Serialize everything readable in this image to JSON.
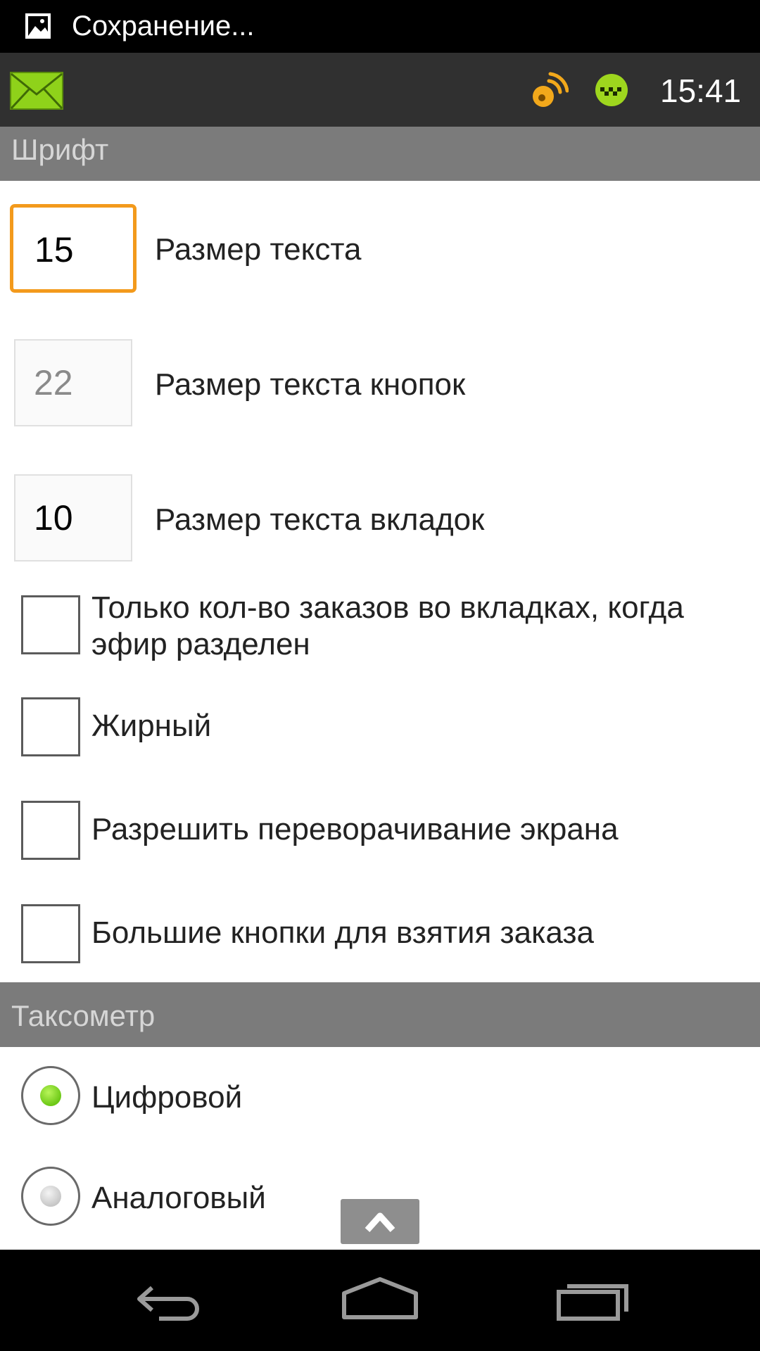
{
  "status_bar": {
    "notification_icon": "image-icon",
    "notification_text": "Сохранение..."
  },
  "app_bar": {
    "mail_icon": "mail-icon",
    "gps_icon": "gps-signal-icon",
    "taxi_icon": "taxi-icon",
    "time": "15:41"
  },
  "sections": {
    "font": "Шрифт",
    "taximeter": "Таксометр"
  },
  "font_settings": {
    "text_size": {
      "value": "15",
      "label": "Размер текста"
    },
    "button_text_size": {
      "value": "22",
      "label": "Размер текста кнопок"
    },
    "tab_text_size": {
      "value": "10",
      "label": "Размер текста вкладок"
    }
  },
  "checkboxes": [
    {
      "label": "Только кол-во заказов во вкладках, когда эфир разделен",
      "checked": false
    },
    {
      "label": "Жирный",
      "checked": false
    },
    {
      "label": "Разрешить переворачивание экрана",
      "checked": false
    },
    {
      "label": "Большие кнопки для взятия заказа",
      "checked": false
    }
  ],
  "taximeter_options": [
    {
      "label": "Цифровой",
      "selected": true
    },
    {
      "label": "Аналоговый",
      "selected": false
    }
  ],
  "colors": {
    "focus_accent": "#f39a1c",
    "radio_selected": "#7ad21c",
    "section_header": "#7b7b7b"
  }
}
